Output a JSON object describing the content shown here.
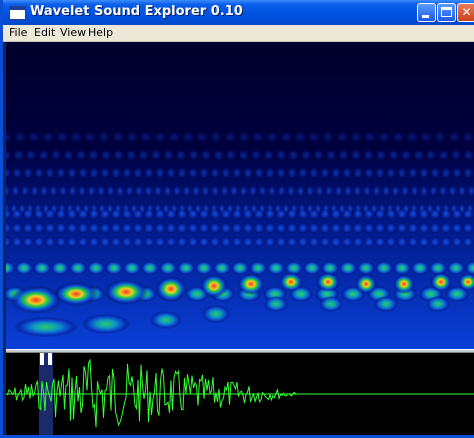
{
  "window": {
    "title": "Wavelet Sound Explorer 0.10"
  },
  "menubar": {
    "items": [
      {
        "label": "File"
      },
      {
        "label": "Edit"
      },
      {
        "label": "View"
      },
      {
        "label": "Help"
      }
    ]
  },
  "controls": {
    "minimize": "minimize-icon",
    "maximize": "maximize-icon",
    "close": "close-icon"
  },
  "colors": {
    "scalogram_background": "#00002a",
    "waveform": "#33ff33",
    "selection": "#1a2a6a"
  }
}
